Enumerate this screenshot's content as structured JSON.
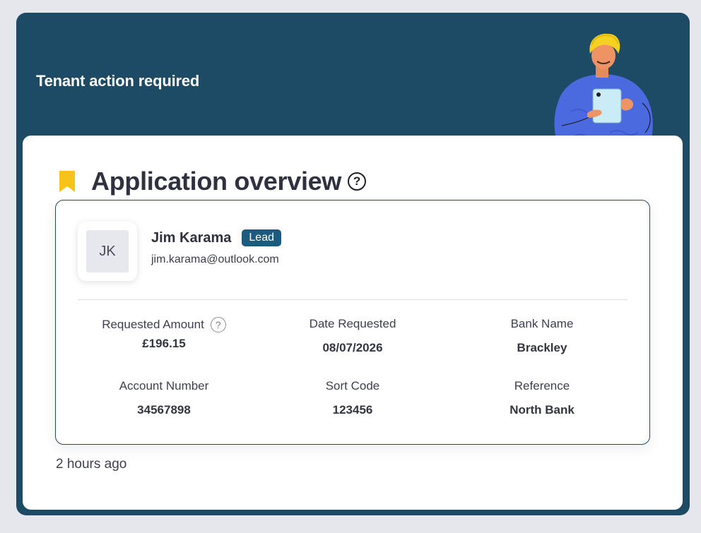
{
  "banner": {
    "title": "Tenant action required"
  },
  "section": {
    "title": "Application overview",
    "help_symbol": "?"
  },
  "applicant": {
    "initials": "JK",
    "name": "Jim Karama",
    "badge": "Lead",
    "email": "jim.karama@outlook.com"
  },
  "fields": [
    {
      "label": "Requested Amount",
      "value": "£196.15",
      "help_symbol": "?"
    },
    {
      "label": "Date Requested",
      "value": "08/07/2026"
    },
    {
      "label": "Bank Name",
      "value": "Brackley"
    },
    {
      "label": "Account Number",
      "value": "34567898"
    },
    {
      "label": "Sort Code",
      "value": "123456"
    },
    {
      "label": "Reference",
      "value": "North Bank"
    }
  ],
  "timestamp": "2 hours ago",
  "colors": {
    "banner": "#1d4a65",
    "badge": "#1d5a7d",
    "bookmark": "#f7c31a",
    "illustration_shirt": "#4b6ae0",
    "illustration_hair": "#f5d121"
  },
  "icons": {
    "bookmark": "bookmark-icon",
    "help": "question-circle-icon",
    "illustration": "person-with-tablet-illustration"
  }
}
